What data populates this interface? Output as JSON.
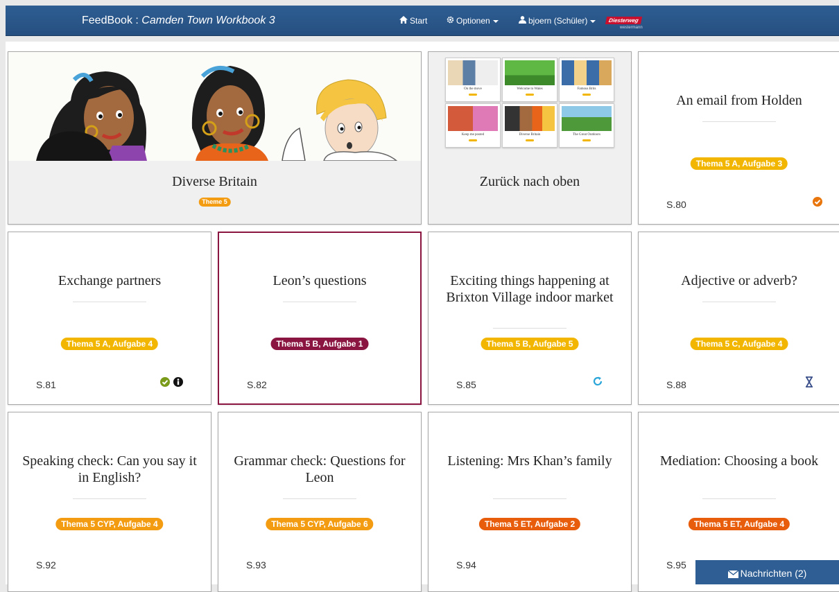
{
  "navbar": {
    "brand_prefix": "FeedBook : ",
    "brand_book": "Camden Town Workbook 3",
    "start": "Start",
    "options": "Optionen",
    "user": "bjoern (Schüler)",
    "logo_main": "Diesterweg",
    "logo_sub": "westermann"
  },
  "hero": {
    "title": "Diverse Britain",
    "badge": "Theme 5"
  },
  "back": {
    "title": "Zurück nach oben",
    "thumbs": [
      "On the move",
      "Welcome to Wales",
      "Famous Brits",
      "Keep me posted",
      "Diverse Britain",
      "The Great Outdoors"
    ]
  },
  "cards": [
    {
      "title": "An email from Holden",
      "badge": "Thema 5 A, Aufgabe 3",
      "page": "S.80"
    },
    {
      "title": "Exchange partners",
      "badge": "Thema 5 A, Aufgabe 4",
      "page": "S.81"
    },
    {
      "title": "Leon’s questions",
      "badge": "Thema 5 B, Aufgabe 1",
      "page": "S.82"
    },
    {
      "title": "Exciting things happening at Brixton Village indoor market",
      "badge": "Thema 5 B, Aufgabe 5",
      "page": "S.85"
    },
    {
      "title": "Adjective or adverb?",
      "badge": "Thema 5 C, Aufgabe 4",
      "page": "S.88"
    },
    {
      "title": "Speaking check: Can you say it in English?",
      "badge": "Thema 5 CYP, Aufgabe 4",
      "page": "S.92"
    },
    {
      "title": "Grammar check: Questions for Leon",
      "badge": "Thema 5 CYP, Aufgabe 6",
      "page": "S.93"
    },
    {
      "title": "Listening: Mrs Khan’s family",
      "badge": "Thema 5 ET, Aufgabe 2",
      "page": "S.94"
    },
    {
      "title": "Mediation: Choosing a book",
      "badge": "Thema 5 ET, Aufgabe 4",
      "page": "S.95"
    }
  ],
  "messages": "Nachrichten (2)",
  "colors": {
    "navbar": "#2e5e93",
    "badge_yellow": "#f2b600",
    "badge_orange": "#f39c12",
    "badge_deep_orange": "#e85d0c",
    "active_maroon": "#8a1540",
    "status_green": "#7a9a1a",
    "status_blue": "#2aa5d8",
    "status_navy": "#3a4f8a"
  },
  "icons": {
    "card0_status": "check-circle-orange",
    "card1_status": [
      "check-circle-green",
      "info-circle-black"
    ],
    "card3_status": "refresh-icon",
    "card4_status": "hourglass-icon"
  }
}
